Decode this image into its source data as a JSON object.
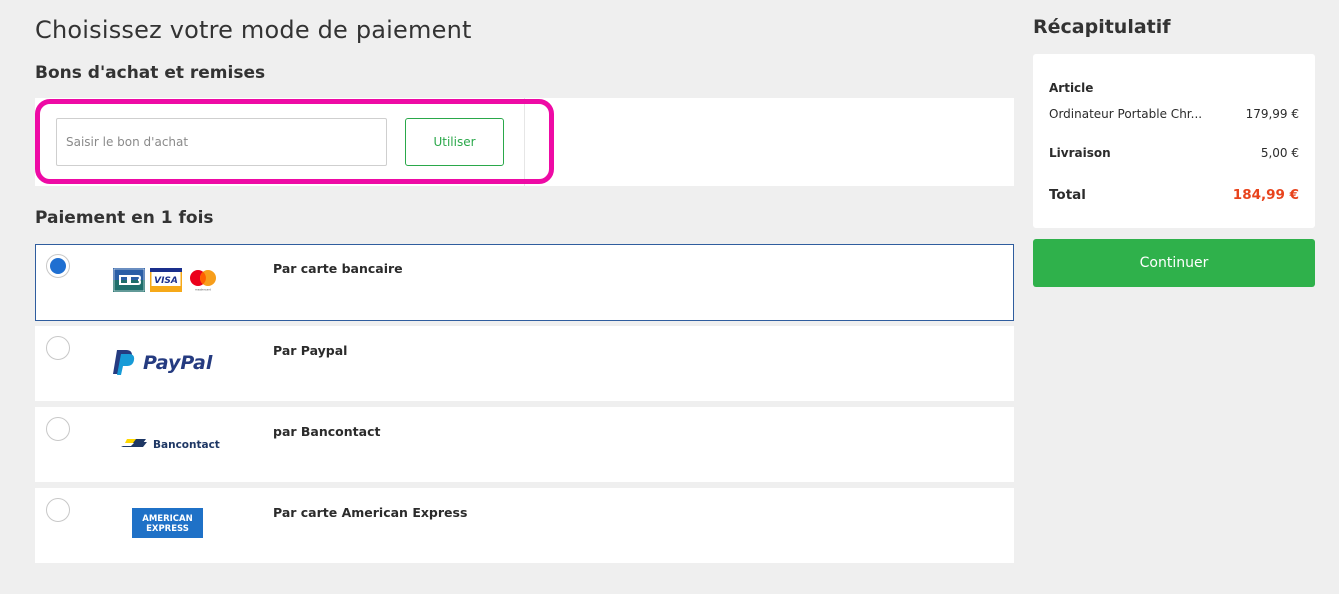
{
  "page": {
    "title": "Choisissez votre mode de paiement"
  },
  "voucher": {
    "section_title": "Bons d'achat et remises",
    "input_placeholder": "Saisir le bon d'achat",
    "input_value": "",
    "apply_label": "Utiliser",
    "highlight_color": "#ee0aa5"
  },
  "payment": {
    "section_title": "Paiement en 1 fois",
    "options": [
      {
        "label": "Par carte bancaire",
        "selected": true,
        "logos": [
          "cb-card-icon",
          "visa-card-icon",
          "mastercard-icon"
        ]
      },
      {
        "label": "Par Paypal",
        "selected": false,
        "logo_text": "PayPal"
      },
      {
        "label": "par Bancontact",
        "selected": false,
        "logo_text": "Bancontact"
      },
      {
        "label": "Par carte American Express",
        "selected": false,
        "logo_text": [
          "AMERICAN",
          "EXPRESS"
        ]
      }
    ]
  },
  "summary": {
    "title": "Récapitulatif",
    "article_label": "Article",
    "article_name": "Ordinateur Portable Chr...",
    "article_price": "179,99 €",
    "shipping_label": "Livraison",
    "shipping_price": "5,00 €",
    "total_label": "Total",
    "total_price": "184,99 €",
    "continue_label": "Continuer"
  },
  "colors": {
    "accent_green": "#2fb14b",
    "total_red": "#e8431c",
    "radio_blue": "#1f6fd1",
    "selected_border": "#2f5d9e",
    "background": "#efefef"
  }
}
